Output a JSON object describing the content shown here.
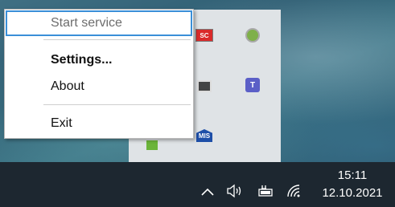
{
  "context_menu": {
    "items": [
      {
        "label": "Start service",
        "enabled": false,
        "focused": true
      },
      {
        "label": "Settings...",
        "bold": true
      },
      {
        "label": "About"
      },
      {
        "label": "Exit"
      }
    ]
  },
  "tray_flyout": {
    "icons": [
      {
        "name": "sc-app-icon",
        "label": "SC"
      },
      {
        "name": "lock-shield-icon"
      },
      {
        "name": "printer-icon"
      },
      {
        "name": "teams-icon",
        "label": "T"
      },
      {
        "name": "mis-app-icon",
        "label": "MIS"
      },
      {
        "name": "green-app-icon"
      }
    ]
  },
  "taskbar": {
    "show_hidden_icon": "chevron-up-icon",
    "volume_icon": "speaker-icon",
    "battery_icon": "battery-charging-icon",
    "network_icon": "wifi-icon",
    "clock": {
      "time": "15:11",
      "date": "12.10.2021"
    }
  },
  "colors": {
    "taskbar": "#1d2730",
    "focus": "#3a8fd8",
    "flyout": "#dfe3e6"
  }
}
